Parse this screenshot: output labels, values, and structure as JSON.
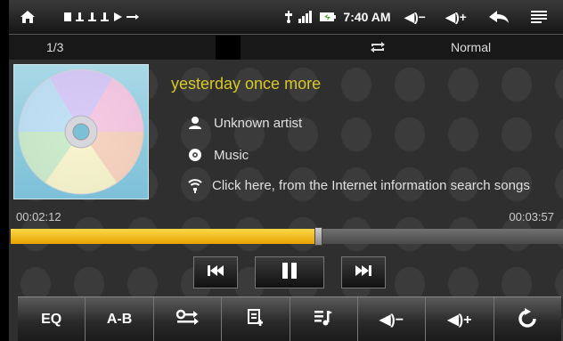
{
  "status_bar": {
    "time": "7:40 AM",
    "volume_down_label": "◀)−",
    "volume_up_label": "◀)+"
  },
  "info_bar": {
    "track_count": "1/3",
    "play_mode": "Normal"
  },
  "track": {
    "title": "yesterday once more",
    "artist": "Unknown artist",
    "album": "Music",
    "search_hint": "Click here, from the Internet information search songs"
  },
  "progress": {
    "elapsed": "00:02:12",
    "total": "00:03:57",
    "fraction": 0.557
  },
  "bottom_bar": {
    "eq_label": "EQ",
    "ab_label": "A-B",
    "vol_down_label": "◀)−",
    "vol_up_label": "◀)+"
  },
  "colors": {
    "title": "#d8c925",
    "progress_fill": "#f2b81a"
  },
  "icons": [
    "home-icon",
    "notification-icons",
    "usb-icon",
    "signal-icon",
    "battery-icon",
    "back-icon",
    "menu-icon",
    "repeat-icon",
    "cd-cover-icon",
    "person-icon",
    "disc-icon",
    "wireless-icon",
    "previous-icon",
    "pause-icon",
    "next-icon",
    "switch-icon",
    "playlist-add-icon",
    "playlist-icon",
    "refresh-icon"
  ]
}
